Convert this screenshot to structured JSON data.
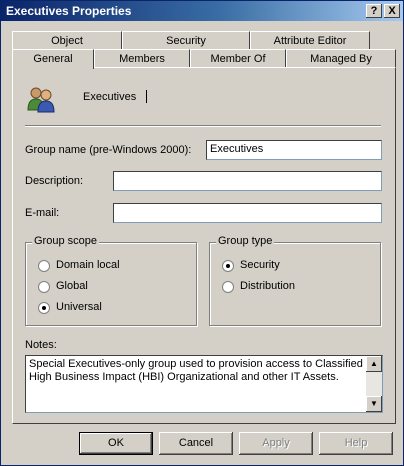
{
  "window": {
    "title": "Executives Properties",
    "help_btn": "?",
    "close_btn": "X"
  },
  "tabs_back": [
    "Object",
    "Security",
    "Attribute Editor"
  ],
  "tabs_front": [
    "General",
    "Members",
    "Member Of",
    "Managed By"
  ],
  "general": {
    "object_name": "Executives",
    "group_name_label": "Group name (pre-Windows 2000):",
    "group_name_value": "Executives",
    "description_label": "Description:",
    "description_value": "",
    "email_label": "E-mail:",
    "email_value": "",
    "group_scope": {
      "legend": "Group scope",
      "options": [
        "Domain local",
        "Global",
        "Universal"
      ],
      "selected": "Universal"
    },
    "group_type": {
      "legend": "Group type",
      "options": [
        "Security",
        "Distribution"
      ],
      "selected": "Security"
    },
    "notes_label": "Notes:",
    "notes_value": "Special Executives-only group used to provision access to Classified High Business Impact (HBI) Organizational and other IT Assets."
  },
  "buttons": {
    "ok": "OK",
    "cancel": "Cancel",
    "apply": "Apply",
    "help": "Help"
  },
  "icons": {
    "group": "users-group-icon"
  }
}
